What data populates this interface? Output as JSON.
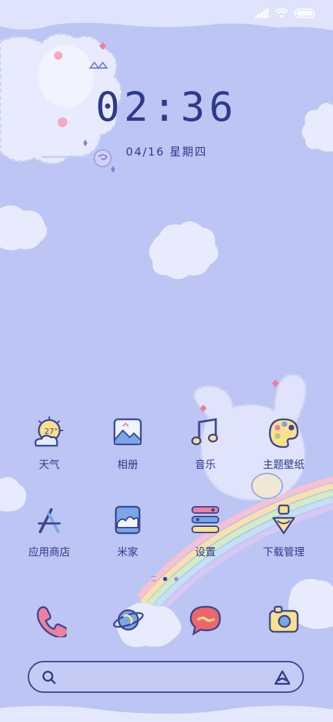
{
  "status_bar": {
    "icons": [
      "signal-icon",
      "wifi-icon",
      "battery-icon"
    ]
  },
  "clock": {
    "time": "02:36",
    "date": "04/16 星期四"
  },
  "apps": [
    {
      "name": "weather",
      "label": "天气",
      "icon": "weather-icon",
      "badge": "27°"
    },
    {
      "name": "gallery",
      "label": "相册",
      "icon": "gallery-icon"
    },
    {
      "name": "music",
      "label": "音乐",
      "icon": "music-icon"
    },
    {
      "name": "themes",
      "label": "主题壁纸",
      "icon": "palette-icon"
    },
    {
      "name": "app-store",
      "label": "应用商店",
      "icon": "app-store-icon"
    },
    {
      "name": "mijia",
      "label": "米家",
      "icon": "mijia-icon"
    },
    {
      "name": "settings",
      "label": "设置",
      "icon": "settings-icon"
    },
    {
      "name": "downloads",
      "label": "下载管理",
      "icon": "download-icon"
    }
  ],
  "page_indicator": {
    "pages": 2,
    "current": 1
  },
  "dock": [
    "phone-icon",
    "browser-icon",
    "messages-icon",
    "camera-icon"
  ],
  "search": {
    "icons": [
      "search-icon",
      "ai-assistant-icon"
    ]
  },
  "colors": {
    "background": "#bcc5f3",
    "accent": "#2d3a8c",
    "cloud": "#e7ebfd",
    "yellow": "#fde08a",
    "pink": "#f07fa0"
  }
}
